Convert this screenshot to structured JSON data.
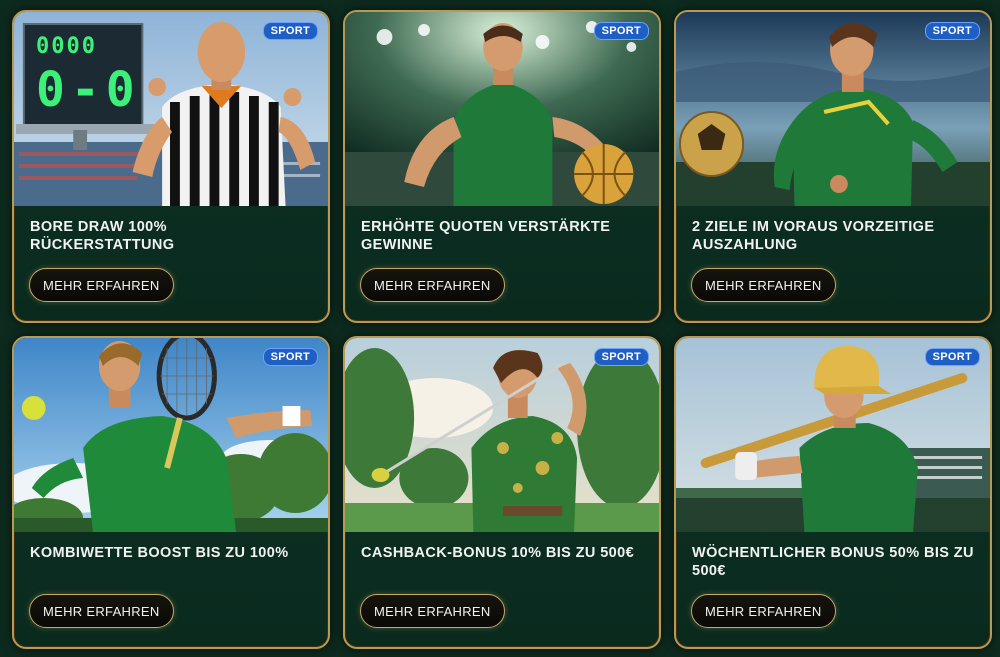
{
  "cards": [
    {
      "badge": "SPORT",
      "title": "BORE DRAW 100% RÜCKERSTATTUNG",
      "button": "MEHR ERFAHREN",
      "image": "referee-scoreboard"
    },
    {
      "badge": "SPORT",
      "title": "ERHÖHTE QUOTEN VERSTÄRKTE GEWINNE",
      "button": "MEHR ERFAHREN",
      "image": "basketball-player"
    },
    {
      "badge": "SPORT",
      "title": "2 ZIELE IM VORAUS VORZEITIGE AUSZAHLUNG",
      "button": "MEHR ERFAHREN",
      "image": "football-player"
    },
    {
      "badge": "SPORT",
      "title": "KOMBIWETTE BOOST BIS ZU 100%",
      "button": "MEHR ERFAHREN",
      "image": "tennis-player"
    },
    {
      "badge": "SPORT",
      "title": "CASHBACK-BONUS 10% BIS ZU 500€",
      "button": "MEHR ERFAHREN",
      "image": "golf-player"
    },
    {
      "badge": "SPORT",
      "title": "WÖCHENTLICHER BONUS 50% BIS ZU 500€",
      "button": "MEHR ERFAHREN",
      "image": "baseball-player"
    }
  ],
  "scoreboard": {
    "top": "0000",
    "score": "0-0"
  },
  "colors": {
    "accent_gold": "#b89a55",
    "badge_blue": "#1f5fc4",
    "card_green": "#0e3325"
  }
}
